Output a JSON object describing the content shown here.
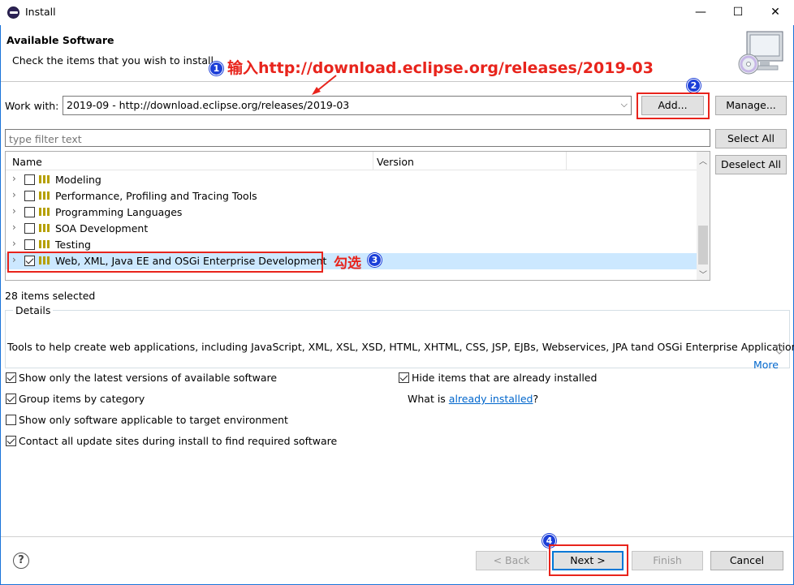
{
  "window": {
    "title": "Install",
    "minimize": "—",
    "maximize": "☐",
    "close": "✕"
  },
  "header": {
    "title": "Available Software",
    "description": "Check the items that you wish to install."
  },
  "annotations": {
    "step1_num": "1",
    "step1_text": "输入http://download.eclipse.org/releases/2019-03",
    "step2_num": "2",
    "step3_num": "3",
    "step3_text": "勾选",
    "step4_num": "4"
  },
  "work_with": {
    "label": "Work with:",
    "value": "2019-09 - http://download.eclipse.org/releases/2019-03",
    "add": "Add...",
    "manage": "Manage..."
  },
  "filter": {
    "placeholder": "type filter text"
  },
  "buttons": {
    "select_all": "Select All",
    "deselect_all": "Deselect All"
  },
  "tree": {
    "columns": [
      "Name",
      "Version"
    ],
    "rows": [
      {
        "label": "Modeling",
        "checked": false
      },
      {
        "label": "Performance, Profiling and Tracing Tools",
        "checked": false
      },
      {
        "label": "Programming Languages",
        "checked": false
      },
      {
        "label": "SOA Development",
        "checked": false
      },
      {
        "label": "Testing",
        "checked": false
      },
      {
        "label": "Web, XML, Java EE and OSGi Enterprise Development",
        "checked": true
      }
    ]
  },
  "status": {
    "selected": "28 items selected"
  },
  "details": {
    "legend": "Details",
    "text": "Tools to help create web applications, including JavaScript, XML, XSL, XSD, HTML, XHTML, CSS, JSP, EJBs, Webservices, JPA tand OSGi Enterprise Applications",
    "more": "More"
  },
  "options": {
    "latest": "Show only the latest versions of available software",
    "group": "Group items by category",
    "target": "Show only software applicable to target environment",
    "contact": "Contact all update sites during install to find required software",
    "hide": "Hide items that are already installed",
    "what_is": "What is",
    "already_installed": "already installed",
    "question": "?"
  },
  "footer": {
    "help": "?",
    "back": "< Back",
    "next": "Next >",
    "finish": "Finish",
    "cancel": "Cancel"
  }
}
